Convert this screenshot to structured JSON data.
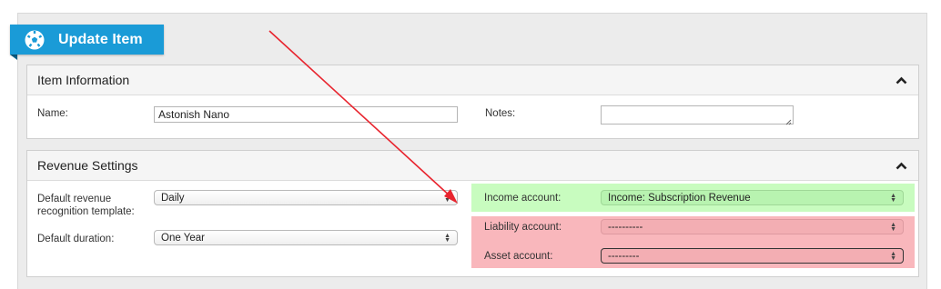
{
  "header": {
    "title": "Update Item",
    "icon": "soccer-ball-icon"
  },
  "item_information": {
    "title": "Item Information",
    "name_label": "Name:",
    "name_value": "Astonish Nano",
    "notes_label": "Notes:",
    "notes_value": ""
  },
  "revenue_settings": {
    "title": "Revenue Settings",
    "template_label_line1": "Default revenue",
    "template_label_line2": "recognition template:",
    "template_value": "Daily",
    "duration_label": "Default duration:",
    "duration_value": "One Year",
    "income_label": "Income account:",
    "income_value": "Income: Subscription Revenue",
    "liability_label": "Liability account:",
    "liability_value": "----------",
    "asset_label": "Asset account:",
    "asset_value": "---------"
  },
  "colors": {
    "header_blue": "#1a9bd7",
    "valid_green": "#c8fcbf",
    "invalid_red": "#f9b7bc",
    "annotation_arrow": "#e8242e"
  }
}
